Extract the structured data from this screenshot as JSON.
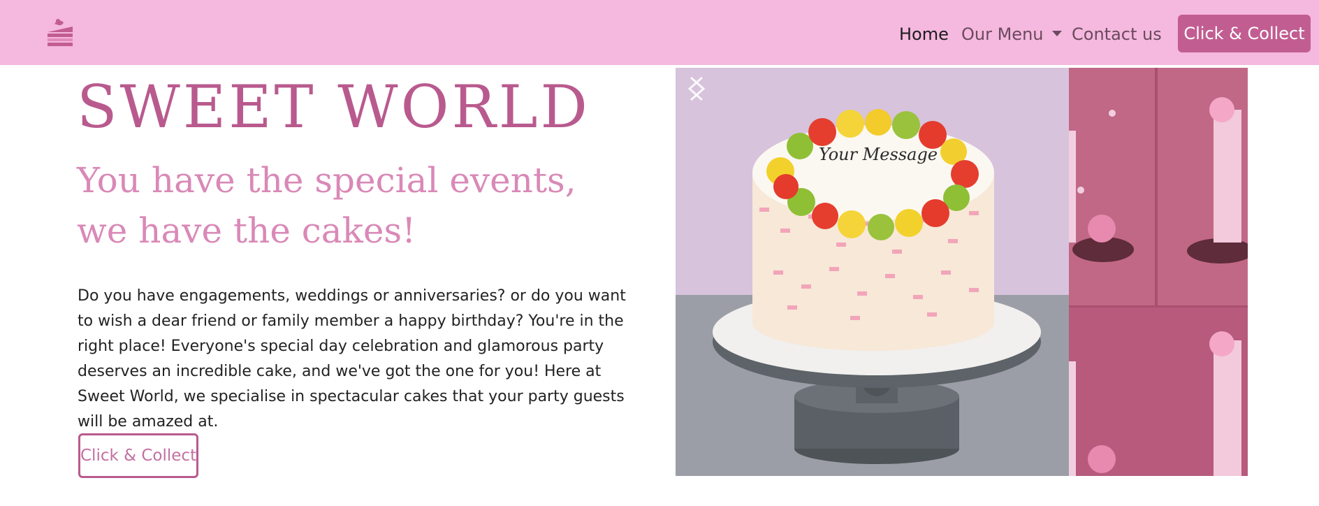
{
  "navbar": {
    "logo_icon": "cake-slice-icon",
    "links": [
      {
        "label": "Home",
        "active": true
      },
      {
        "label": "Our Menu",
        "dropdown": true
      },
      {
        "label": "Contact us"
      }
    ],
    "cta_label": "Click & Collect"
  },
  "hero": {
    "title": "SWEET WORLD",
    "subtitle": "You have the special events, we have the cakes!",
    "body": "Do you have engagements, weddings or anniversaries? or do you want to wish a dear friend or family member a happy birthday? You're in the right place! Everyone's special day celebration and glamorous party deserves an incredible cake, and we've got the one for you! Here at Sweet World, we specialise in spectacular cakes that your party guests will be amazed at.",
    "cta_label": "Click & Collect"
  },
  "carousel": {
    "slides": [
      {
        "image": "fruit-topped-cake-photo",
        "cake_text": "Your Message"
      },
      {
        "image": "pink-drip-cake-photo"
      }
    ],
    "prev_icon": "chevron-left-icon",
    "next_icon": "chevron-right-icon"
  },
  "colors": {
    "navbar_bg": "#f5b8de",
    "brand_accent": "#c25d92",
    "title": "#b95a8e",
    "subtitle": "#d989b7"
  }
}
